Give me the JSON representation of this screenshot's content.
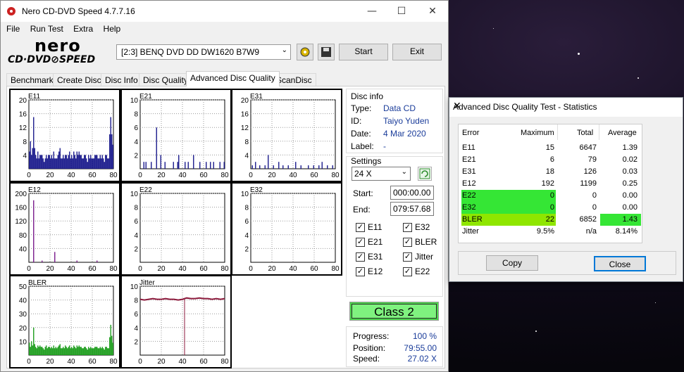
{
  "window": {
    "title": "Nero CD-DVD Speed 4.7.7.16",
    "min": "—",
    "max": "☐",
    "close": "✕"
  },
  "menu": [
    "File",
    "Run Test",
    "Extra",
    "Help"
  ],
  "logo": {
    "line1": "nero",
    "line2": "CD·DVD⊘SPEED"
  },
  "drive": {
    "value": "[2:3]  BENQ DVD DD DW1620 B7W9"
  },
  "toolbar": {
    "start": "Start",
    "exit": "Exit",
    "config_icon": "wrench-icon",
    "save_icon": "floppy-icon"
  },
  "tabs": [
    "Benchmark",
    "Create Disc",
    "Disc Info",
    "Disc Quality",
    "Advanced Disc Quality",
    "ScanDisc"
  ],
  "active_tab": "Advanced Disc Quality",
  "disc_info": {
    "header": "Disc info",
    "type_label": "Type:",
    "type": "Data CD",
    "id_label": "ID:",
    "id": "Taiyo Yuden",
    "date_label": "Date:",
    "date": "4 Mar 2020",
    "label_label": "Label:",
    "label": "-"
  },
  "settings": {
    "header": "Settings",
    "speed": "24 X",
    "start_label": "Start:",
    "start": "000:00.00",
    "end_label": "End:",
    "end": "079:57.68",
    "checks": [
      {
        "label": "E11",
        "checked": true
      },
      {
        "label": "E32",
        "checked": true
      },
      {
        "label": "E21",
        "checked": true
      },
      {
        "label": "BLER",
        "checked": true
      },
      {
        "label": "E31",
        "checked": true
      },
      {
        "label": "Jitter",
        "checked": true
      },
      {
        "label": "E12",
        "checked": true
      },
      {
        "label": "E22",
        "checked": true
      }
    ]
  },
  "class_label": "Class 2",
  "progress": {
    "progress_label": "Progress:",
    "progress": "100 %",
    "position_label": "Position:",
    "position": "79:55.00",
    "speed_label": "Speed:",
    "speed": "27.02 X"
  },
  "chart_data": [
    {
      "type": "bar",
      "name": "E11",
      "x_ticks": [
        "0",
        "20",
        "40",
        "60",
        "80"
      ],
      "y_ticks": [
        "20",
        "16",
        "12",
        "8",
        "4"
      ],
      "ylim": [
        0,
        20
      ],
      "xlim": [
        0,
        80
      ],
      "color": "#1a1a8c",
      "grid": true,
      "values": [
        5,
        8,
        4,
        6,
        15,
        6,
        4,
        3,
        5,
        3,
        4,
        4,
        4,
        3,
        2,
        3,
        4,
        3,
        4,
        4,
        3,
        4,
        3,
        5,
        3,
        3,
        3,
        4,
        5,
        6,
        3,
        3,
        4,
        3,
        4,
        4,
        3,
        4,
        5,
        3,
        4,
        3,
        5,
        4,
        3,
        5,
        4,
        5,
        4,
        4,
        3,
        3,
        4,
        4,
        3,
        2,
        4,
        3,
        4,
        3,
        3,
        3,
        4,
        4,
        4,
        3,
        3,
        4,
        3,
        4,
        3,
        2,
        4,
        4,
        3,
        3,
        10,
        15,
        10,
        7
      ]
    },
    {
      "type": "bar",
      "name": "E21",
      "x_ticks": [
        "0",
        "20",
        "40",
        "60",
        "80"
      ],
      "y_ticks": [
        "10",
        "8",
        "6",
        "4",
        "2"
      ],
      "ylim": [
        0,
        10
      ],
      "xlim": [
        0,
        80
      ],
      "color": "#1a1a8c",
      "grid": true,
      "values": [
        0,
        0,
        0,
        1,
        0,
        1,
        0,
        0,
        0,
        0,
        1,
        0,
        0,
        0,
        0,
        6,
        0,
        0,
        0,
        2,
        0,
        0,
        0,
        1,
        0,
        0,
        0,
        0,
        0,
        0,
        0,
        1,
        0,
        0,
        0,
        1,
        2,
        0,
        0,
        0,
        0,
        0,
        1,
        0,
        0,
        1,
        0,
        0,
        0,
        0,
        2,
        0,
        0,
        0,
        0,
        0,
        1,
        0,
        0,
        0,
        0,
        0,
        1,
        0,
        0,
        0,
        1,
        0,
        0,
        1,
        0,
        0,
        0,
        0,
        0,
        1,
        0,
        0,
        0,
        1
      ]
    },
    {
      "type": "bar",
      "name": "E31",
      "x_ticks": [
        "0",
        "20",
        "40",
        "60",
        "80"
      ],
      "y_ticks": [
        "20",
        "16",
        "12",
        "8",
        "4"
      ],
      "ylim": [
        0,
        20
      ],
      "xlim": [
        0,
        80
      ],
      "color": "#1a1a8c",
      "grid": true,
      "values": [
        0,
        1,
        0,
        0,
        2,
        0,
        0,
        0,
        1,
        0,
        0,
        0,
        0,
        1,
        0,
        0,
        4,
        0,
        0,
        0,
        0,
        1,
        0,
        0,
        0,
        0,
        2,
        0,
        0,
        0,
        1,
        0,
        0,
        0,
        0,
        1,
        0,
        0,
        0,
        0,
        0,
        0,
        2,
        0,
        0,
        0,
        0,
        1,
        0,
        0,
        0,
        0,
        0,
        0,
        1,
        0,
        0,
        0,
        0,
        1,
        0,
        0,
        0,
        0,
        1,
        0,
        0,
        2,
        0,
        0,
        0,
        0,
        1,
        0,
        0,
        0,
        0,
        1,
        0,
        0
      ]
    },
    {
      "type": "bar",
      "name": "E12",
      "x_ticks": [
        "0",
        "20",
        "40",
        "60",
        "80"
      ],
      "y_ticks": [
        "200",
        "160",
        "120",
        "80",
        "40"
      ],
      "ylim": [
        0,
        200
      ],
      "xlim": [
        0,
        80
      ],
      "color": "#7a1a8c",
      "grid": true,
      "values": [
        0,
        0,
        0,
        0,
        180,
        0,
        0,
        0,
        0,
        0,
        0,
        0,
        5,
        0,
        0,
        0,
        0,
        0,
        0,
        0,
        0,
        0,
        0,
        0,
        30,
        0,
        0,
        0,
        0,
        0,
        0,
        0,
        0,
        0,
        0,
        0,
        0,
        0,
        0,
        0,
        0,
        0,
        0,
        0,
        0,
        5,
        0,
        0,
        0,
        0,
        0,
        0,
        0,
        0,
        0,
        0,
        0,
        0,
        0,
        0,
        0,
        0,
        0,
        0,
        5,
        0,
        0,
        0,
        0,
        0,
        0,
        0,
        0,
        0,
        0,
        0,
        0,
        0,
        0,
        0
      ]
    },
    {
      "type": "bar",
      "name": "E22",
      "x_ticks": [
        "0",
        "20",
        "40",
        "60",
        "80"
      ],
      "y_ticks": [
        "10",
        "8",
        "6",
        "4",
        "2"
      ],
      "ylim": [
        0,
        10
      ],
      "xlim": [
        0,
        80
      ],
      "color": "#1a1a8c",
      "grid": true,
      "values": []
    },
    {
      "type": "bar",
      "name": "E32",
      "x_ticks": [
        "0",
        "20",
        "40",
        "60",
        "80"
      ],
      "y_ticks": [
        "10",
        "8",
        "6",
        "4",
        "2"
      ],
      "ylim": [
        0,
        10
      ],
      "xlim": [
        0,
        80
      ],
      "color": "#1a1a8c",
      "grid": true,
      "values": []
    },
    {
      "type": "bar",
      "name": "BLER",
      "x_ticks": [
        "0",
        "20",
        "40",
        "60",
        "80"
      ],
      "y_ticks": [
        "50",
        "40",
        "30",
        "20",
        "10"
      ],
      "ylim": [
        0,
        50
      ],
      "xlim": [
        0,
        80
      ],
      "color": "#1e9e1e",
      "grid": true,
      "values": [
        9,
        6,
        10,
        7,
        20,
        8,
        6,
        5,
        7,
        6,
        7,
        6,
        6,
        5,
        4,
        6,
        7,
        5,
        6,
        6,
        5,
        6,
        5,
        7,
        5,
        6,
        5,
        6,
        7,
        8,
        5,
        5,
        6,
        5,
        7,
        6,
        5,
        6,
        7,
        5,
        6,
        5,
        7,
        6,
        5,
        7,
        6,
        7,
        6,
        6,
        5,
        5,
        6,
        6,
        5,
        4,
        6,
        5,
        6,
        5,
        5,
        5,
        6,
        6,
        6,
        5,
        5,
        6,
        5,
        6,
        5,
        4,
        6,
        6,
        5,
        5,
        13,
        22,
        14,
        9
      ]
    },
    {
      "type": "line",
      "name": "Jitter",
      "x_ticks": [
        "0",
        "20",
        "40",
        "60",
        "80"
      ],
      "y_ticks": [
        "10",
        "8",
        "6",
        "4",
        "2"
      ],
      "ylim": [
        0,
        10
      ],
      "xlim": [
        0,
        80
      ],
      "color": "#8c1a3c",
      "grid": true,
      "x": [
        0,
        4,
        8,
        12,
        16,
        20,
        24,
        28,
        32,
        36,
        40,
        44,
        48,
        52,
        56,
        60,
        64,
        68,
        72,
        76,
        80
      ],
      "values": [
        8.1,
        8.0,
        8.1,
        8.2,
        8.1,
        8.1,
        8.2,
        8.1,
        8.1,
        8.0,
        8.1,
        8.3,
        8.2,
        8.2,
        8.3,
        8.2,
        8.2,
        8.1,
        8.2,
        8.1,
        8.2
      ]
    }
  ],
  "stats": {
    "title": "Advanced Disc Quality Test - Statistics",
    "close": "✕",
    "headers": [
      "Error",
      "Maximum",
      "Total",
      "Average"
    ],
    "rows": [
      [
        "E11",
        "15",
        "6647",
        "1.39"
      ],
      [
        "E21",
        "6",
        "79",
        "0.02"
      ],
      [
        "E31",
        "18",
        "126",
        "0.03"
      ],
      [
        "E12",
        "192",
        "1199",
        "0.25"
      ],
      [
        "E22",
        "0",
        "0",
        "0.00"
      ],
      [
        "E32",
        "0",
        "0",
        "0.00"
      ],
      [
        "BLER",
        "22",
        "6852",
        "1.43"
      ],
      [
        "Jitter",
        "9.5%",
        "n/a",
        "8.14%"
      ]
    ],
    "copy": "Copy",
    "close_btn": "Close",
    "highlight_green": "#35e635",
    "highlight_lime": "#8fe600"
  }
}
